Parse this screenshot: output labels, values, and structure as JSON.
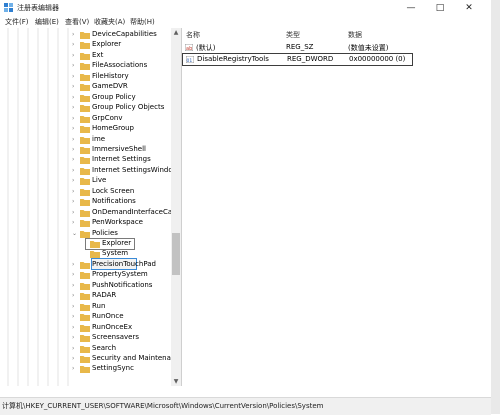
{
  "window": {
    "title": "注册表编辑器"
  },
  "menubar": [
    "文件(F)",
    "编辑(E)",
    "查看(V)",
    "收藏夹(A)",
    "帮助(H)"
  ],
  "tree": {
    "items": [
      {
        "label": "DeviceCapabilities",
        "arrow": "›"
      },
      {
        "label": "Explorer",
        "arrow": "›"
      },
      {
        "label": "Ext",
        "arrow": "›"
      },
      {
        "label": "FileAssociations",
        "arrow": "›"
      },
      {
        "label": "FileHistory",
        "arrow": "›"
      },
      {
        "label": "GameDVR",
        "arrow": "›"
      },
      {
        "label": "Group Policy",
        "arrow": "›"
      },
      {
        "label": "Group Policy Objects",
        "arrow": "›"
      },
      {
        "label": "GrpConv",
        "arrow": "›"
      },
      {
        "label": "HomeGroup",
        "arrow": "›"
      },
      {
        "label": "ime",
        "arrow": "›"
      },
      {
        "label": "ImmersiveShell",
        "arrow": "›"
      },
      {
        "label": "Internet Settings",
        "arrow": "›"
      },
      {
        "label": "Internet SettingsWindow",
        "arrow": "›"
      },
      {
        "label": "Live",
        "arrow": "›"
      },
      {
        "label": "Lock Screen",
        "arrow": "›"
      },
      {
        "label": "Notifications",
        "arrow": "›"
      },
      {
        "label": "OnDemandInterfaceCach",
        "arrow": "›"
      },
      {
        "label": "PenWorkspace",
        "arrow": "›"
      },
      {
        "label": "Policies",
        "arrow": "⌄"
      },
      {
        "label": "Explorer",
        "arrow": ""
      },
      {
        "label": "System",
        "arrow": ""
      },
      {
        "label": "PrecisionTouchPad",
        "arrow": "›"
      },
      {
        "label": "PropertySystem",
        "arrow": "›"
      },
      {
        "label": "PushNotifications",
        "arrow": "›"
      },
      {
        "label": "RADAR",
        "arrow": "›"
      },
      {
        "label": "Run",
        "arrow": "›"
      },
      {
        "label": "RunOnce",
        "arrow": "›"
      },
      {
        "label": "RunOnceEx",
        "arrow": "›"
      },
      {
        "label": "Screensavers",
        "arrow": "›"
      },
      {
        "label": "Search",
        "arrow": "›"
      },
      {
        "label": "Security and Maintenanc",
        "arrow": "›"
      },
      {
        "label": "SettingSync",
        "arrow": "›"
      }
    ]
  },
  "list": {
    "columns": [
      "名称",
      "类型",
      "数据"
    ],
    "rows": [
      {
        "name": "(默认)",
        "type": "REG_SZ",
        "data": "(数值未设置)"
      },
      {
        "name": "DisableRegistryTools",
        "type": "REG_DWORD",
        "data": "0x00000000 (0)"
      }
    ]
  },
  "status": {
    "path": "计算机\\HKEY_CURRENT_USER\\SOFTWARE\\Microsoft\\Windows\\CurrentVersion\\Policies\\System"
  },
  "colors": {
    "folder": "#e8b84a",
    "selection_border": "#3a8ad6"
  }
}
